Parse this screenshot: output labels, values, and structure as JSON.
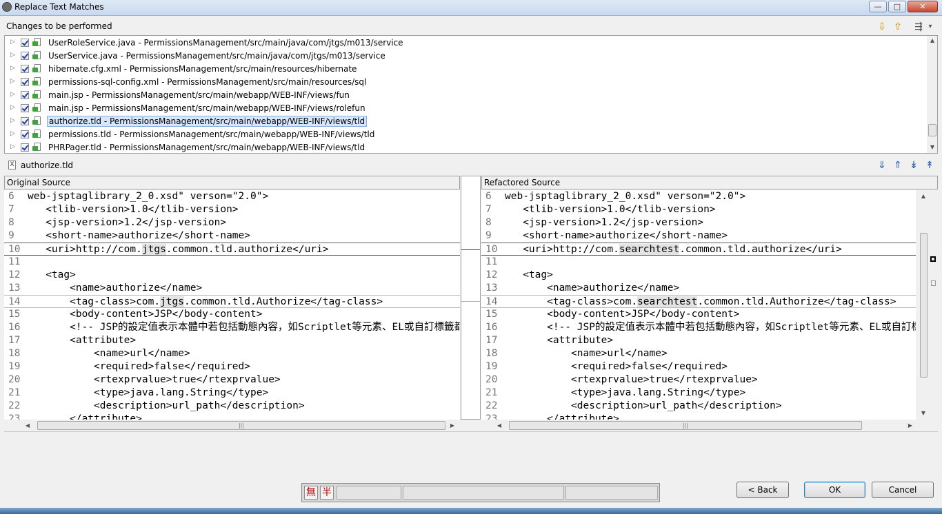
{
  "window": {
    "title": "Replace Text Matches",
    "minimize_glyph": "—",
    "maximize_glyph": "□",
    "close_glyph": "✕"
  },
  "changes": {
    "label": "Changes to be performed",
    "toolbar_icons": [
      "down-arrow-icon",
      "up-arrow-icon",
      "filter-icon",
      "dropdown-icon"
    ],
    "toolbar_glyphs": [
      "⇩",
      "⇧",
      "⇶",
      "▾"
    ],
    "items": [
      {
        "label": "UserRoleService.java - PermissionsManagement/src/main/java/com/jtgs/m013/service",
        "checked": true
      },
      {
        "label": "UserService.java - PermissionsManagement/src/main/java/com/jtgs/m013/service",
        "checked": true
      },
      {
        "label": "hibernate.cfg.xml - PermissionsManagement/src/main/resources/hibernate",
        "checked": true
      },
      {
        "label": "permissions-sql-config.xml - PermissionsManagement/src/main/resources/sql",
        "checked": true
      },
      {
        "label": "main.jsp - PermissionsManagement/src/main/webapp/WEB-INF/views/fun",
        "checked": true
      },
      {
        "label": "main.jsp - PermissionsManagement/src/main/webapp/WEB-INF/views/rolefun",
        "checked": true
      },
      {
        "label": "authorize.tld - PermissionsManagement/src/main/webapp/WEB-INF/views/tld",
        "checked": true,
        "selected": true
      },
      {
        "label": "permissions.tld - PermissionsManagement/src/main/webapp/WEB-INF/views/tld",
        "checked": true
      },
      {
        "label": "PHRPager.tld - PermissionsManagement/src/main/webapp/WEB-INF/views/tld",
        "checked": true
      }
    ]
  },
  "file": {
    "name": "authorize.tld",
    "icon_letter": "X",
    "nav_icons": [
      "next-change-icon",
      "previous-change-icon",
      "next-difference-icon",
      "previous-difference-icon"
    ],
    "nav_glyphs": [
      "⇓",
      "⇑",
      "↡",
      "↟"
    ]
  },
  "original": {
    "header": "Original Source",
    "lines": [
      {
        "n": "6",
        "text": "web-jsptaglibrary_2_0.xsd\" verson=\"2.0\">"
      },
      {
        "n": "7",
        "text": "   <tlib-version>1.0</tlib-version>"
      },
      {
        "n": "8",
        "text": "   <jsp-version>1.2</jsp-version>"
      },
      {
        "n": "9",
        "text": "   <short-name>authorize</short-name>"
      },
      {
        "n": "10",
        "pre": "   <uri>http://com.",
        "word": "jtgs",
        "post": ".common.tld.authorize</uri>",
        "changed": true
      },
      {
        "n": "11",
        "text": ""
      },
      {
        "n": "12",
        "text": "   <tag>"
      },
      {
        "n": "13",
        "text": "       <name>authorize</name>"
      },
      {
        "n": "14",
        "pre": "       <tag-class>com.",
        "word": "jtgs",
        "post": ".common.tld.Authorize</tag-class>",
        "changed": true
      },
      {
        "n": "15",
        "text": "       <body-content>JSP</body-content>"
      },
      {
        "n": "16",
        "text": "       <!-- JSP的設定值表示本體中若包括動態內容，如Scriptlet等元素、EL或自訂標籤都會被執行，"
      },
      {
        "n": "17",
        "text": "       <attribute>"
      },
      {
        "n": "18",
        "text": "           <name>url</name>"
      },
      {
        "n": "19",
        "text": "           <required>false</required>"
      },
      {
        "n": "20",
        "text": "           <rtexprvalue>true</rtexprvalue>"
      },
      {
        "n": "21",
        "text": "           <type>java.lang.String</type>"
      },
      {
        "n": "22",
        "text": "           <description>url_path</description>"
      },
      {
        "n": "23",
        "text": "       </attribute>"
      }
    ]
  },
  "refactored": {
    "header": "Refactored Source",
    "lines": [
      {
        "n": "6",
        "text": "web-jsptaglibrary_2_0.xsd\" verson=\"2.0\">"
      },
      {
        "n": "7",
        "text": "   <tlib-version>1.0</tlib-version>"
      },
      {
        "n": "8",
        "text": "   <jsp-version>1.2</jsp-version>"
      },
      {
        "n": "9",
        "text": "   <short-name>authorize</short-name>"
      },
      {
        "n": "10",
        "pre": "   <uri>http://com.",
        "word": "searchtest",
        "post": ".common.tld.authorize</uri>",
        "changed": true
      },
      {
        "n": "11",
        "text": ""
      },
      {
        "n": "12",
        "text": "   <tag>"
      },
      {
        "n": "13",
        "text": "       <name>authorize</name>"
      },
      {
        "n": "14",
        "pre": "       <tag-class>com.",
        "word": "searchtest",
        "post": ".common.tld.Authorize</tag-class>",
        "changed": true
      },
      {
        "n": "15",
        "text": "       <body-content>JSP</body-content>"
      },
      {
        "n": "16",
        "text": "       <!-- JSP的設定值表示本體中若包括動態內容，如Scriptlet等元素、EL或自訂標籤都會被執行，"
      },
      {
        "n": "17",
        "text": "       <attribute>"
      },
      {
        "n": "18",
        "text": "           <name>url</name>"
      },
      {
        "n": "19",
        "text": "           <required>false</required>"
      },
      {
        "n": "20",
        "text": "           <rtexprvalue>true</rtexprvalue>"
      },
      {
        "n": "21",
        "text": "           <type>java.lang.String</type>"
      },
      {
        "n": "22",
        "text": "           <description>url_path</description>"
      },
      {
        "n": "23",
        "text": "       </attribute>"
      }
    ]
  },
  "buttons": {
    "back": "< Back",
    "ok": "OK",
    "cancel": "Cancel"
  },
  "ime": {
    "key1": "無",
    "key2": "半"
  }
}
